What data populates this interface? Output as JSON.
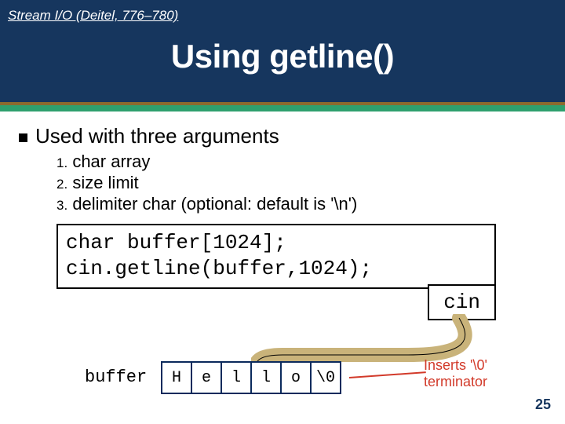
{
  "header": {
    "topic": "Stream I/O (Deitel, 776–780)",
    "title": "Using getline()"
  },
  "bullet": "Used with three arguments",
  "args": [
    {
      "n": "1.",
      "text": "char array"
    },
    {
      "n": "2.",
      "text": "size limit"
    },
    {
      "n": "3.",
      "text": "delimiter char (optional: default is '\\n')"
    }
  ],
  "code": {
    "line1": "char buffer[1024];",
    "line2": "cin.getline(buffer,1024);"
  },
  "cin_label": "cin",
  "buffer_label": "buffer",
  "cells": [
    "H",
    "e",
    "l",
    "l",
    "o",
    "\\0"
  ],
  "callout": {
    "line1": "Inserts '\\0'",
    "line2": "terminator"
  },
  "page": "25"
}
